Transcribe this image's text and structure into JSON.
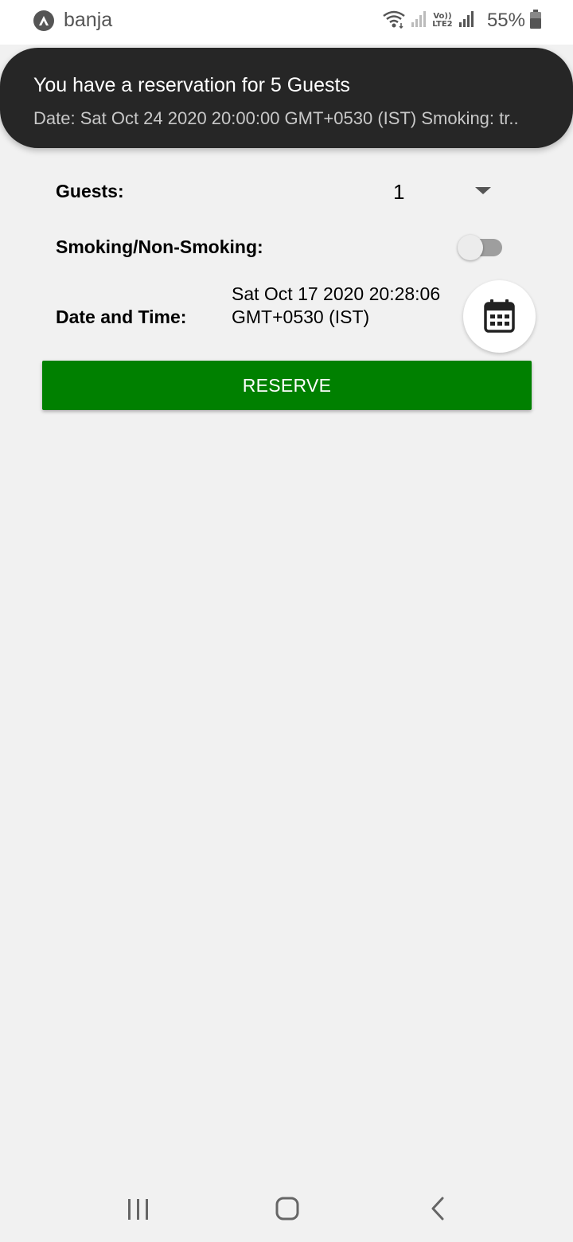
{
  "status_bar": {
    "app_icon": "app-logo-icon",
    "app_name": "banja",
    "network_label": "Vo)) LTE2",
    "battery_percent": "55%",
    "icons": [
      "wifi-icon",
      "signal-icon",
      "signal-icon",
      "battery-icon"
    ]
  },
  "notification": {
    "title": "You have a reservation for 5 Guests",
    "body": "Date: Sat Oct 24 2020 20:00:00 GMT+0530 (IST) Smoking: tr.."
  },
  "form": {
    "guests_label": "Guests:",
    "guests_value": "1",
    "smoking_label": "Smoking/Non-Smoking:",
    "smoking_enabled": false,
    "date_label": "Date and Time:",
    "date_value": "Sat Oct 17 2020 20:28:06 GMT+0530 (IST)",
    "calendar_icon": "calendar-icon"
  },
  "reserve_button": {
    "label": "RESERVE",
    "color": "#008000"
  },
  "nav_bar": {
    "icons": [
      "recents-icon",
      "home-icon",
      "back-icon"
    ]
  }
}
